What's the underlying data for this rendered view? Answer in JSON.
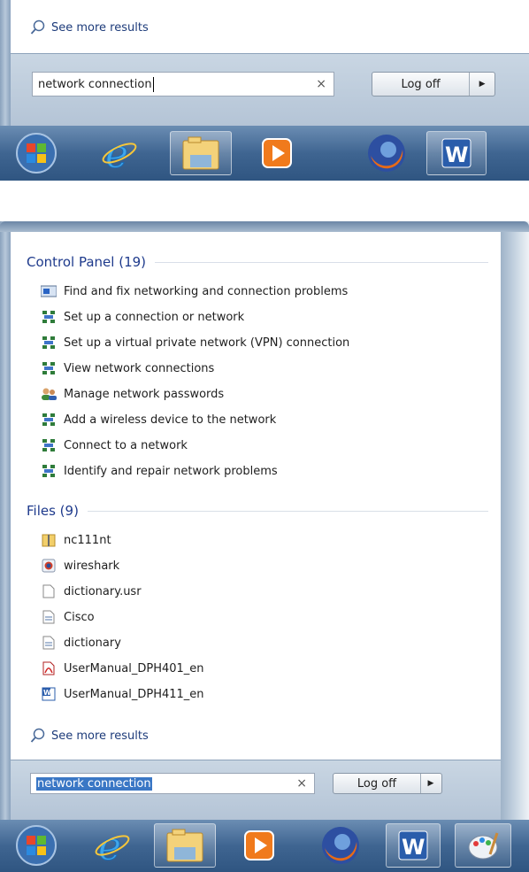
{
  "top": {
    "see_more": "See more results",
    "search_value": "network connection",
    "logoff_label": "Log off"
  },
  "bottom": {
    "control_panel_header": "Control Panel (19)",
    "control_panel_items": [
      {
        "label": "Find and fix networking and connection problems",
        "icon": "troubleshoot-icon"
      },
      {
        "label": "Set up a connection or network",
        "icon": "network-icon"
      },
      {
        "label": "Set up a virtual private network (VPN) connection",
        "icon": "network-icon"
      },
      {
        "label": "View network connections",
        "icon": "network-icon"
      },
      {
        "label": "Manage network passwords",
        "icon": "users-icon"
      },
      {
        "label": "Add a wireless device to the network",
        "icon": "network-icon"
      },
      {
        "label": "Connect to a network",
        "icon": "network-icon"
      },
      {
        "label": "Identify and repair network problems",
        "icon": "network-icon"
      }
    ],
    "files_header": "Files (9)",
    "files_items": [
      {
        "label": "nc111nt",
        "icon": "zip-folder-icon"
      },
      {
        "label": "wireshark",
        "icon": "wireshark-icon"
      },
      {
        "label": "dictionary.usr",
        "icon": "blank-file-icon"
      },
      {
        "label": "Cisco",
        "icon": "text-file-icon"
      },
      {
        "label": "dictionary",
        "icon": "text-file-icon"
      },
      {
        "label": "UserManual_DPH401_en",
        "icon": "pdf-icon"
      },
      {
        "label": "UserManual_DPH411_en",
        "icon": "word-doc-icon"
      }
    ],
    "see_more": "See more results",
    "search_value": "network connection",
    "logoff_label": "Log off"
  },
  "taskbar_apps": [
    "start-orb-icon",
    "internet-explorer-icon",
    "file-explorer-icon",
    "media-player-icon",
    "firefox-icon",
    "word-icon",
    "paint-icon"
  ]
}
